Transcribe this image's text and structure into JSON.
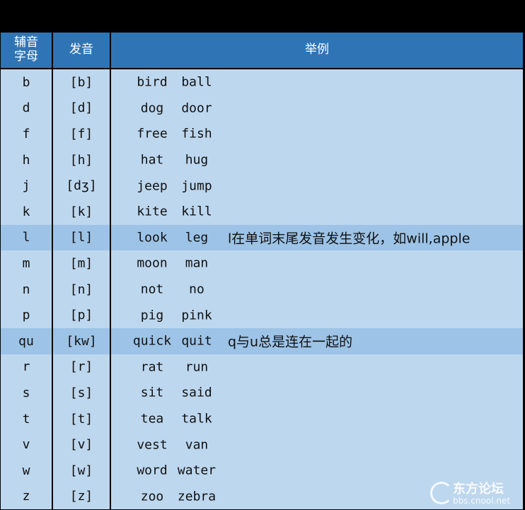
{
  "header": {
    "col_letter": "辅音\n字母",
    "col_sound": "发音",
    "col_examples": "举例"
  },
  "rows": [
    {
      "letter": "b",
      "sound": "[b]",
      "ex1": "bird",
      "ex2": "ball",
      "note": ""
    },
    {
      "letter": "d",
      "sound": "[d]",
      "ex1": "dog",
      "ex2": "door",
      "note": ""
    },
    {
      "letter": "f",
      "sound": "[f]",
      "ex1": "free",
      "ex2": "fish",
      "note": ""
    },
    {
      "letter": "h",
      "sound": "[h]",
      "ex1": "hat",
      "ex2": "hug",
      "note": ""
    },
    {
      "letter": "j",
      "sound": "[dʒ]",
      "ex1": "jeep",
      "ex2": "jump",
      "note": ""
    },
    {
      "letter": "k",
      "sound": "[k]",
      "ex1": "kite",
      "ex2": "kill",
      "note": ""
    },
    {
      "letter": "l",
      "sound": "[l]",
      "ex1": "look",
      "ex2": "leg",
      "note": "l在单词末尾发音发生变化，如will,apple",
      "highlight": true
    },
    {
      "letter": "m",
      "sound": "[m]",
      "ex1": "moon",
      "ex2": "man",
      "note": ""
    },
    {
      "letter": "n",
      "sound": "[n]",
      "ex1": "not",
      "ex2": "no",
      "note": ""
    },
    {
      "letter": "p",
      "sound": "[p]",
      "ex1": "pig",
      "ex2": "pink",
      "note": ""
    },
    {
      "letter": "qu",
      "sound": "[kw]",
      "ex1": "quick",
      "ex2": "quit",
      "note": "q与u总是连在一起的",
      "highlight": true
    },
    {
      "letter": "r",
      "sound": "[r]",
      "ex1": "rat",
      "ex2": "run",
      "note": ""
    },
    {
      "letter": "s",
      "sound": "[s]",
      "ex1": "sit",
      "ex2": "said",
      "note": ""
    },
    {
      "letter": "t",
      "sound": "[t]",
      "ex1": "tea",
      "ex2": "talk",
      "note": ""
    },
    {
      "letter": "v",
      "sound": "[v]",
      "ex1": "vest",
      "ex2": "van",
      "note": ""
    },
    {
      "letter": "w",
      "sound": "[w]",
      "ex1": "word",
      "ex2": "water",
      "note": ""
    },
    {
      "letter": "z",
      "sound": "[z]",
      "ex1": "zoo",
      "ex2": "zebra",
      "note": ""
    }
  ],
  "watermark": {
    "name": "东方论坛",
    "url": "bbs.cnool.net"
  },
  "colors": {
    "header_bg": "#2f75b5",
    "row_bg": "#bdd7ee",
    "highlight_bg": "#9dc3e6"
  }
}
